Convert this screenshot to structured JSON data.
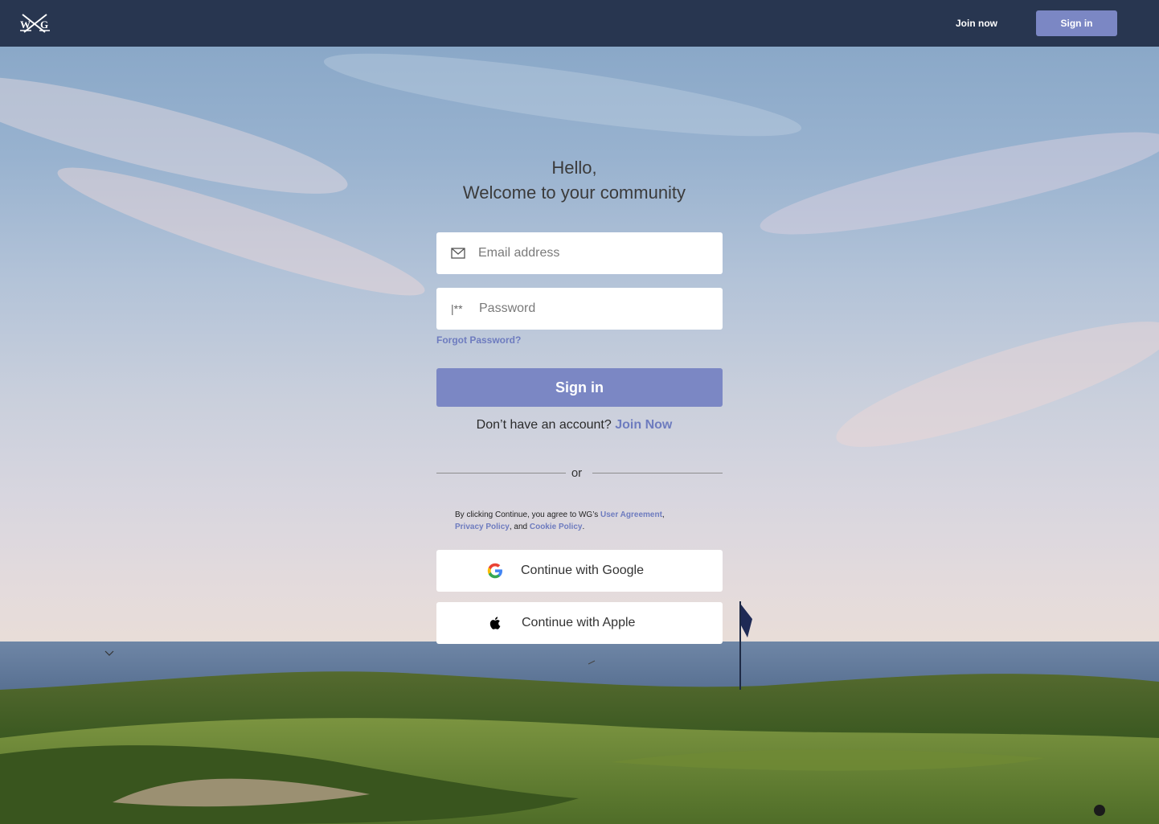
{
  "header": {
    "logo_alt": "WG",
    "join_label": "Join now",
    "signin_label": "Sign in"
  },
  "form": {
    "greeting_line1": "Hello,",
    "greeting_line2": "Welcome to your community",
    "email_placeholder": "Email address",
    "password_placeholder": "Password",
    "password_icon": "|**",
    "forgot_label": "Forgot Password?",
    "signin_label": "Sign in",
    "no_account_text": "Don’t have an account?",
    "join_now_label": "Join Now",
    "divider_text": "or"
  },
  "terms": {
    "prefix": "By clicking Continue, you agree to WG’s ",
    "user_agreement": "User Agreement",
    "sep1": ",",
    "privacy_policy": "Privacy Policy",
    "sep2": ", and ",
    "cookie_policy": "Cookie Policy",
    "end": "."
  },
  "social": {
    "google_label": "Continue with Google",
    "apple_label": "Continue with Apple"
  },
  "colors": {
    "topbar": "#283650",
    "accent": "#7b87c4",
    "link": "#6e7cbf"
  }
}
